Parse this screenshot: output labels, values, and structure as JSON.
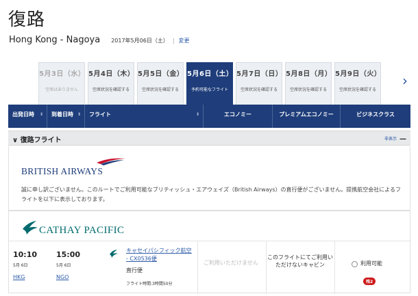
{
  "page": {
    "title": "復路",
    "route": "Hong Kong - Nagoya",
    "date": "2017年5月06日（土）",
    "separator": "|",
    "change_label": "変更"
  },
  "date_tabs": [
    {
      "date": "5月3日（水）",
      "status": "空席はありません"
    },
    {
      "date": "5月4日（木）",
      "status": "空席状況を確認する"
    },
    {
      "date": "5月5日（金）",
      "status": "空席状況を確認する"
    },
    {
      "date": "5月6日（土）",
      "status": "予約可能なフライト"
    },
    {
      "date": "5月7日（日）",
      "status": "空席状況を確認する"
    },
    {
      "date": "5月8日（月）",
      "status": "空席状況を確認する"
    },
    {
      "date": "5月9日（火）",
      "status": "空席状況を確認する"
    }
  ],
  "next_arrow": "›",
  "table_header": {
    "departure": "出発日時",
    "arrival": "到着日時",
    "flight": "フライト",
    "economy": "エコノミー",
    "premium_economy": "プレミアムエコノミー",
    "business": "ビジネスクラス",
    "sort_icon": "⇕"
  },
  "section": {
    "title": "復路フライト",
    "toggle_label": "非表示",
    "toggle_icon": "—",
    "chevron": "∨"
  },
  "ba": {
    "logo_text": "BRITISH AIRWAYS",
    "message": "誠に申し訳ございません。このルートでご利用可能なブリティッシュ・エアウェイズ（British Airways）の直行便がございません。提携航空会社によるフライトを以下に表示しております。"
  },
  "cx": {
    "logo_text": "CATHAY PACIFIC",
    "flight": {
      "dep_time": "10:10",
      "dep_date": "5月 6日",
      "dep_airport": "HKG",
      "arr_time": "15:00",
      "arr_date": "5月 6日",
      "arr_airport": "NGO",
      "carrier_flight": "キャセイパシフィック航空 - CX0536便",
      "type": "直行便",
      "duration": "フライト時間:3時間50分",
      "economy": "ご利用いただけません",
      "premium_economy": "このフライトにてご利用いただけないキャビン",
      "business_status": "利用可能",
      "seats_left": "残2"
    }
  },
  "colors": {
    "navy": "#1e3d7a",
    "link": "#2a5aa8",
    "ba_red": "#c8102e",
    "cx_green": "#006b6e",
    "badge_red": "#cc1a1a"
  }
}
